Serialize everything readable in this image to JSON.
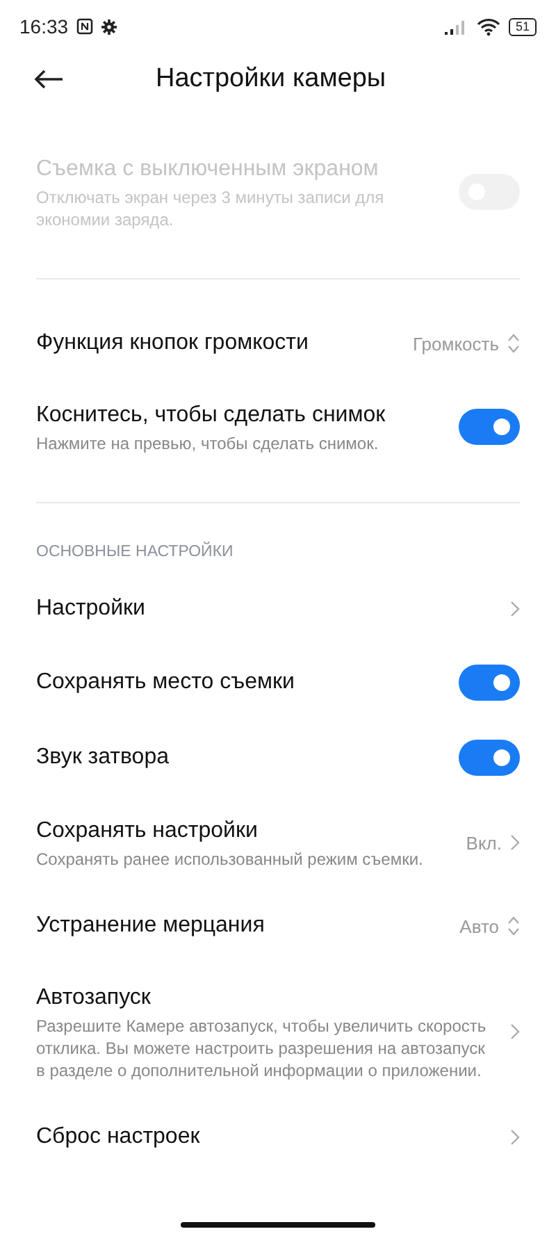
{
  "status_bar": {
    "time": "16:33",
    "battery": "51"
  },
  "header": {
    "title": "Настройки камеры"
  },
  "sections": [
    {
      "items": [
        {
          "kind": "toggle",
          "title": "Съемка с выключенным экраном",
          "subtitle": "Отключать экран через 3 минуты записи для экономии заряда.",
          "on": false,
          "disabled": true
        }
      ]
    },
    {
      "items": [
        {
          "kind": "select",
          "title": "Функция кнопок громкости",
          "value": "Громкость"
        },
        {
          "kind": "toggle",
          "title": "Коснитесь, чтобы сделать снимок",
          "subtitle": "Нажмите на превью, чтобы сделать снимок.",
          "on": true,
          "disabled": false
        }
      ]
    },
    {
      "header": "ОСНОВНЫЕ НАСТРОЙКИ",
      "items": [
        {
          "kind": "link",
          "title": "Настройки"
        },
        {
          "kind": "toggle",
          "title": "Сохранять место съемки",
          "on": true,
          "disabled": false
        },
        {
          "kind": "toggle",
          "title": "Звук затвора",
          "on": true,
          "disabled": false
        },
        {
          "kind": "link",
          "title": "Сохранять настройки",
          "subtitle": "Сохранять ранее использованный режим съемки.",
          "value": "Вкл."
        },
        {
          "kind": "select",
          "title": "Устранение мерцания",
          "value": "Авто"
        },
        {
          "kind": "link",
          "title": "Автозапуск",
          "subtitle": "Разрешите Камере автозапуск, чтобы увеличить скорость отклика. Вы можете настроить разрешения на автозапуск в разделе о дополнительной информации о приложении."
        },
        {
          "kind": "link",
          "title": "Сброс настроек"
        }
      ]
    }
  ]
}
